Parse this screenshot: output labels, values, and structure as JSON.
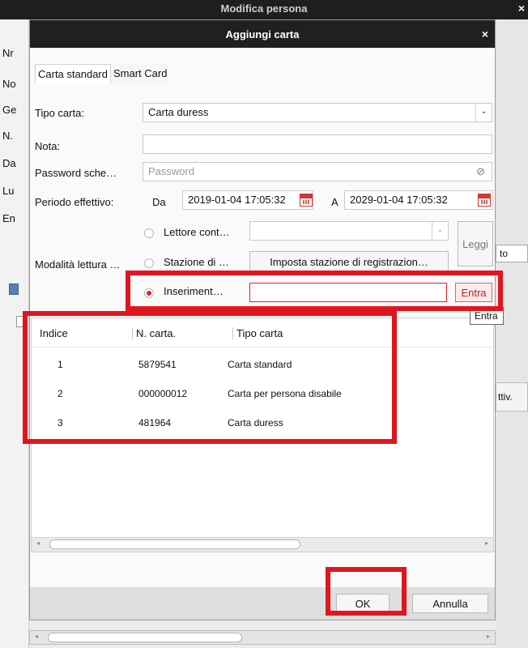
{
  "parent": {
    "title": "Modifica persona",
    "close": "×",
    "side_labels": [
      "Nr",
      "No",
      "Ge",
      "N.",
      "Da",
      "Lu",
      "En"
    ],
    "right_field": "to",
    "right_button": "ttiv."
  },
  "dialog": {
    "title": "Aggiungi carta",
    "close": "×",
    "tabs": [
      "Carta standard",
      "Smart Card"
    ],
    "tipo_carta": {
      "label": "Tipo carta:",
      "value": "Carta duress",
      "arrow": "⌄"
    },
    "nota": {
      "label": "Nota:",
      "value": ""
    },
    "password": {
      "label": "Password sche…",
      "placeholder": "Password",
      "icon": "⊘"
    },
    "periodo": {
      "label": "Periodo effettivo:",
      "da": "Da",
      "from": "2019-01-04 17:05:32",
      "a": "A",
      "to": "2029-01-04 17:05:32"
    },
    "modalita": {
      "label": "Modalità lettura …",
      "options": [
        {
          "label": "Lettore cont…",
          "selected": false
        },
        {
          "label": "Stazione di …",
          "selected": false
        },
        {
          "label": "Inseriment…",
          "selected": true
        }
      ],
      "reader_select": "",
      "reader_arrow": "⌄",
      "station_value": "Imposta stazione di registrazion…",
      "input_value": "",
      "leggi": "Leggi",
      "entra": "Entra",
      "tooltip": "Entra"
    },
    "table": {
      "columns": [
        "Indice",
        "N. carta.",
        "Tipo carta"
      ],
      "rows": [
        [
          "1",
          "5879541",
          "Carta standard"
        ],
        [
          "2",
          "000000012",
          "Carta per persona disabile"
        ],
        [
          "3",
          "481964",
          "Carta duress"
        ]
      ]
    },
    "ok": "OK",
    "cancel": "Annulla"
  },
  "colors": {
    "highlight": "#e0161e",
    "accent": "#d9242b",
    "titlebar": "#202020"
  },
  "icons": [
    "close-icon",
    "dropdown-arrow-icon",
    "eye-hidden-icon",
    "calendar-icon",
    "radio-icon",
    "scroll-left-icon",
    "scroll-right-icon"
  ]
}
